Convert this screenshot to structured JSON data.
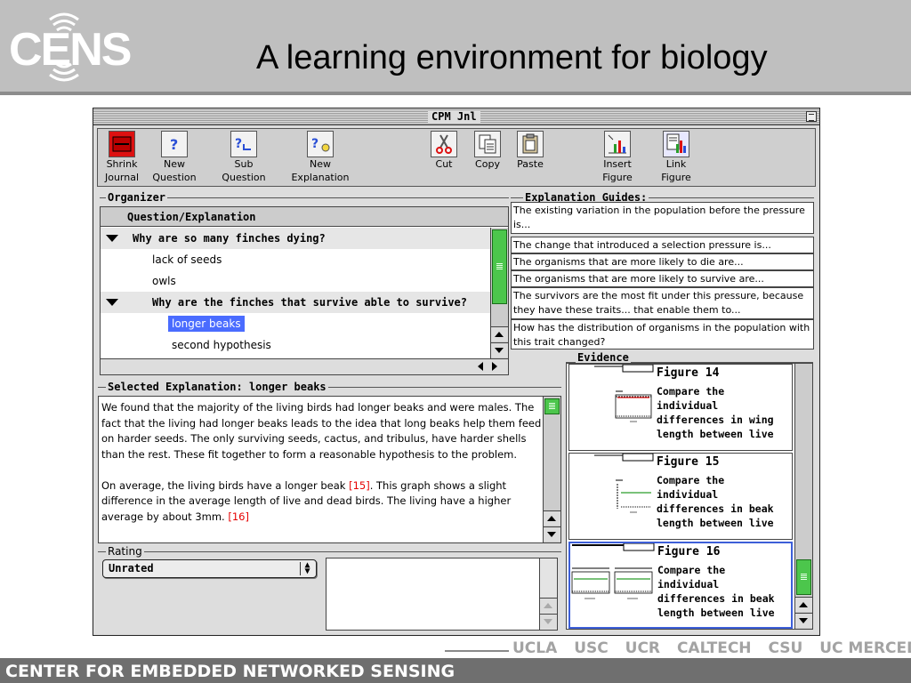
{
  "slide": {
    "logo_text": "CENS",
    "title": "A learning environment for biology",
    "footer": "CENTER FOR EMBEDDED NETWORKED SENSING",
    "universities": [
      "UCLA",
      "USC",
      "UCR",
      "CALTECH",
      "CSU",
      "UC MERCED"
    ]
  },
  "window": {
    "title": "CPM Jnl",
    "toolbar": [
      {
        "label1": "Shrink",
        "label2": "Journal",
        "icon": "shrink-journal-icon"
      },
      {
        "label1": "New",
        "label2": "Question",
        "icon": "new-question-icon"
      },
      {
        "label1": "Sub",
        "label2": "Question",
        "icon": "sub-question-icon"
      },
      {
        "label1": "New",
        "label2": "Explanation",
        "icon": "new-explanation-icon"
      },
      {
        "label1": "Cut",
        "label2": "",
        "icon": "scissors-icon"
      },
      {
        "label1": "Copy",
        "label2": "",
        "icon": "copy-icon"
      },
      {
        "label1": "Paste",
        "label2": "",
        "icon": "paste-icon"
      },
      {
        "label1": "Insert",
        "label2": "Figure",
        "icon": "insert-figure-icon"
      },
      {
        "label1": "Link",
        "label2": "Figure",
        "icon": "link-figure-icon"
      }
    ]
  },
  "organizer": {
    "label": "Organizer",
    "header": "Question/Explanation",
    "rows": [
      {
        "text": "Why are so many finches dying?",
        "kind": "question"
      },
      {
        "text": "lack of seeds",
        "kind": "explanation"
      },
      {
        "text": "owls",
        "kind": "explanation"
      },
      {
        "text": "Why are the finches that survive able to survive?",
        "kind": "question"
      },
      {
        "text": "longer beaks",
        "kind": "explanation",
        "selected": true
      },
      {
        "text": "second hypothesis",
        "kind": "explanation"
      }
    ]
  },
  "guides": {
    "label": "Explanation Guides:",
    "items": [
      "The existing variation in the population before the pressure is...",
      "The change that introduced a selection pressure is...",
      "The organisms that are more likely to die are...",
      "The organisms that are more likely to survive are...",
      "The survivors are the most fit under this pressure, because they have these traits... that enable them to...",
      "How has the distribution of organisms in the population with this trait changed?"
    ]
  },
  "selected_explanation": {
    "label": "Selected Explanation: longer beaks",
    "p1": "We found that the majority of the living birds had longer beaks and were males.  The fact that the living had longer beaks leads to the idea that long beaks help them feed on harder seeds.  The only surviving seeds, cactus, and tribulus, have harder shells than the rest.  These fit together to form a reasonable hypothesis to the problem.",
    "p2a": "On average, the living birds have a longer beak ",
    "ref1": "[15]",
    "p2b": ".  This graph shows a slight difference in the average length of live and dead birds.  The living have a higher average by about 3mm. ",
    "ref2": "[16]"
  },
  "rating": {
    "label": "Rating",
    "value": "Unrated"
  },
  "evidence": {
    "label": "Evidence",
    "items": [
      {
        "title": "Figure 14",
        "desc": "Compare the individual differences in wing length between live"
      },
      {
        "title": "Figure 15",
        "desc": "Compare the individual differences in beak length between live"
      },
      {
        "title": "Figure 16",
        "desc": "Compare the individual differences in beak length between live",
        "active": true
      }
    ]
  }
}
